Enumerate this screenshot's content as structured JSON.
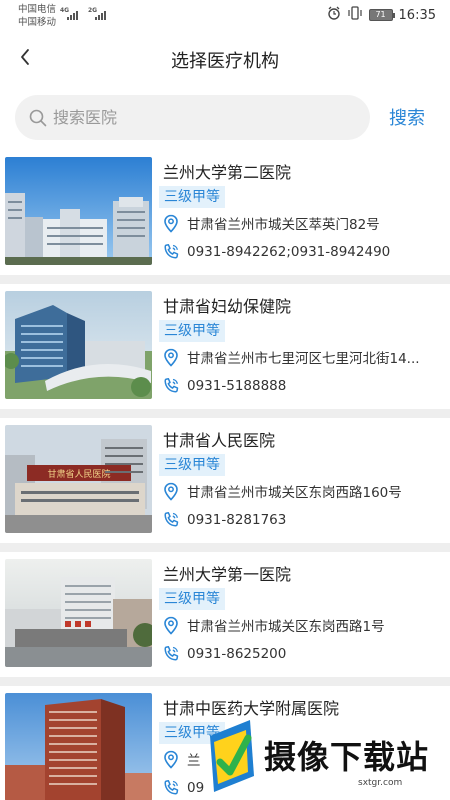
{
  "status_bar": {
    "carrier1": "中国电信",
    "carrier2": "中国移动",
    "net1": "4G",
    "net2": "2G",
    "battery": "71",
    "time": "16:35"
  },
  "header": {
    "title": "选择医疗机构"
  },
  "search": {
    "placeholder": "搜索医院",
    "button": "搜索"
  },
  "hospitals": [
    {
      "name": "兰州大学第二医院",
      "level": "三级甲等",
      "address": "甘肃省兰州市城关区萃英门82号",
      "phone": "0931-8942262;0931-8942490"
    },
    {
      "name": "甘肃省妇幼保健院",
      "level": "三级甲等",
      "address": "甘肃省兰州市七里河区七里河北街14...",
      "phone": "0931-5188888"
    },
    {
      "name": "甘肃省人民医院",
      "level": "三级甲等",
      "address": "甘肃省兰州市城关区东岗西路160号",
      "phone": "0931-8281763"
    },
    {
      "name": "兰州大学第一医院",
      "level": "三级甲等",
      "address": "甘肃省兰州市城关区东岗西路1号",
      "phone": "0931-8625200"
    },
    {
      "name": "甘肃中医药大学附属医院",
      "level": "三级甲等",
      "address": "兰",
      "phone": "09"
    }
  ],
  "images": {
    "sign_text": "甘肃省人民医院"
  },
  "watermark": {
    "text": "摄像下载站",
    "url": "sxtgr.com"
  },
  "icons": {
    "back": "chevron-left-icon",
    "search": "search-icon",
    "location": "location-pin-icon",
    "phone": "phone-icon"
  },
  "colors": {
    "accent": "#2a86d6",
    "tag_bg": "#e3f1fb"
  }
}
